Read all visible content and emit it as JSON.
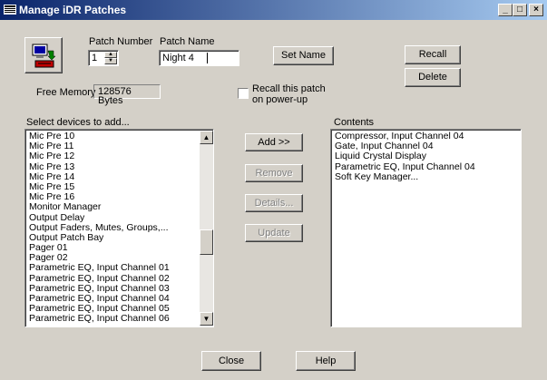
{
  "window": {
    "title": "Manage iDR Patches",
    "controls": [
      "_",
      "□",
      "×"
    ]
  },
  "patch": {
    "number_label": "Patch Number",
    "number_value": "1",
    "name_label": "Patch Name",
    "name_value": "Night 4"
  },
  "buttons": {
    "set_name": "Set Name",
    "recall": "Recall",
    "delete": "Delete",
    "add": "Add >>",
    "remove": "Remove",
    "details": "Details...",
    "update": "Update",
    "close": "Close",
    "help": "Help"
  },
  "memory": {
    "label": "Free Memory",
    "value": "128576 Bytes"
  },
  "recall_checkbox": {
    "label_line1": "Recall this patch",
    "label_line2": "on power-up",
    "checked": false
  },
  "devices": {
    "label": "Select devices to add...",
    "items": [
      "Mic Pre 10",
      "Mic Pre 11",
      "Mic Pre 12",
      "Mic Pre 13",
      "Mic Pre 14",
      "Mic Pre 15",
      "Mic Pre 16",
      "Monitor Manager",
      "Output Delay",
      "Output Faders, Mutes, Groups,...",
      "Output Patch Bay",
      "Pager 01",
      "Pager 02",
      "Parametric EQ, Input Channel 01",
      "Parametric EQ, Input Channel 02",
      "Parametric EQ, Input Channel 03",
      "Parametric EQ, Input Channel 04",
      "Parametric EQ, Input Channel 05",
      "Parametric EQ, Input Channel 06"
    ]
  },
  "contents": {
    "label": "Contents",
    "items": [
      "Compressor, Input Channel 04",
      "Gate, Input Channel 04",
      "Liquid Crystal Display",
      "Parametric EQ, Input Channel 04",
      "Soft Key Manager..."
    ]
  }
}
